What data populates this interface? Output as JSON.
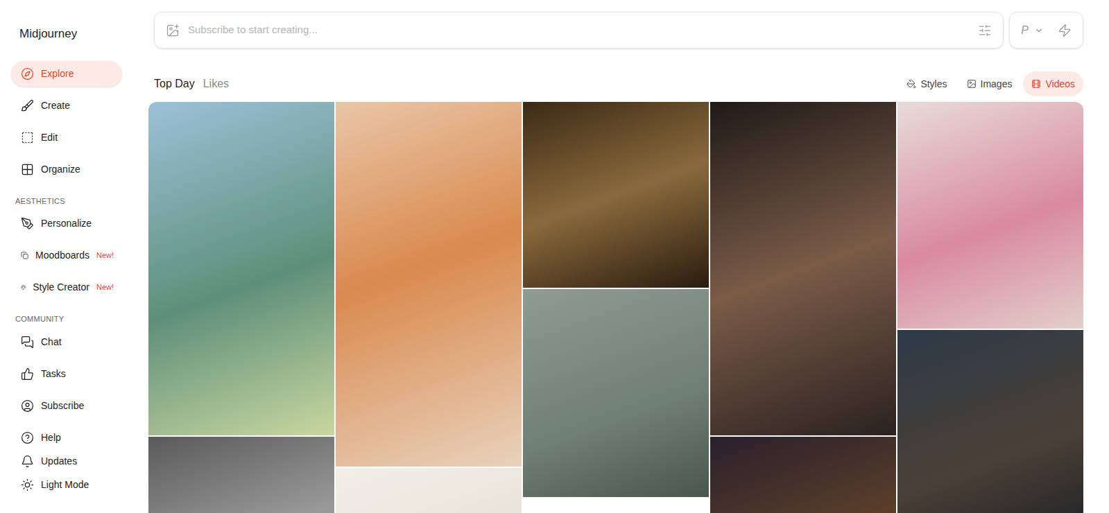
{
  "app": {
    "title": "Midjourney"
  },
  "sidebar": {
    "groups": [
      {
        "heading": "",
        "items": [
          {
            "label": "Explore",
            "selected": true,
            "badge": ""
          },
          {
            "label": "Create",
            "selected": false,
            "badge": ""
          },
          {
            "label": "Edit",
            "selected": false,
            "badge": ""
          },
          {
            "label": "Organize",
            "selected": false,
            "badge": ""
          }
        ]
      },
      {
        "heading": "AESTHETICS",
        "items": [
          {
            "label": "Personalize",
            "selected": false,
            "badge": ""
          },
          {
            "label": "Moodboards",
            "selected": false,
            "badge": "New!"
          },
          {
            "label": "Style Creator",
            "selected": false,
            "badge": "New!"
          }
        ]
      },
      {
        "heading": "COMMUNITY",
        "items": [
          {
            "label": "Chat",
            "selected": false,
            "badge": ""
          },
          {
            "label": "Tasks",
            "selected": false,
            "badge": ""
          },
          {
            "label": "Subscribe",
            "selected": false,
            "badge": ""
          }
        ]
      }
    ],
    "footer": [
      {
        "label": "Help"
      },
      {
        "label": "Updates"
      },
      {
        "label": "Light Mode"
      }
    ]
  },
  "prompt": {
    "placeholder": "Subscribe to start creating...",
    "mode": "P"
  },
  "tabs": [
    {
      "label": "Top Day",
      "selected": true
    },
    {
      "label": "Likes",
      "selected": false
    }
  ],
  "filters": [
    {
      "label": "Styles",
      "selected": false
    },
    {
      "label": "Images",
      "selected": false
    },
    {
      "label": "Videos",
      "selected": true
    }
  ],
  "gallery": {
    "tiles": [
      {
        "kind": "image"
      },
      {
        "kind": "image"
      },
      {
        "kind": "image"
      },
      {
        "kind": "image"
      },
      {
        "kind": "image"
      },
      {
        "kind": "image"
      },
      {
        "kind": "image"
      },
      {
        "kind": "image"
      },
      {
        "kind": "image"
      },
      {
        "kind": "image"
      }
    ]
  }
}
